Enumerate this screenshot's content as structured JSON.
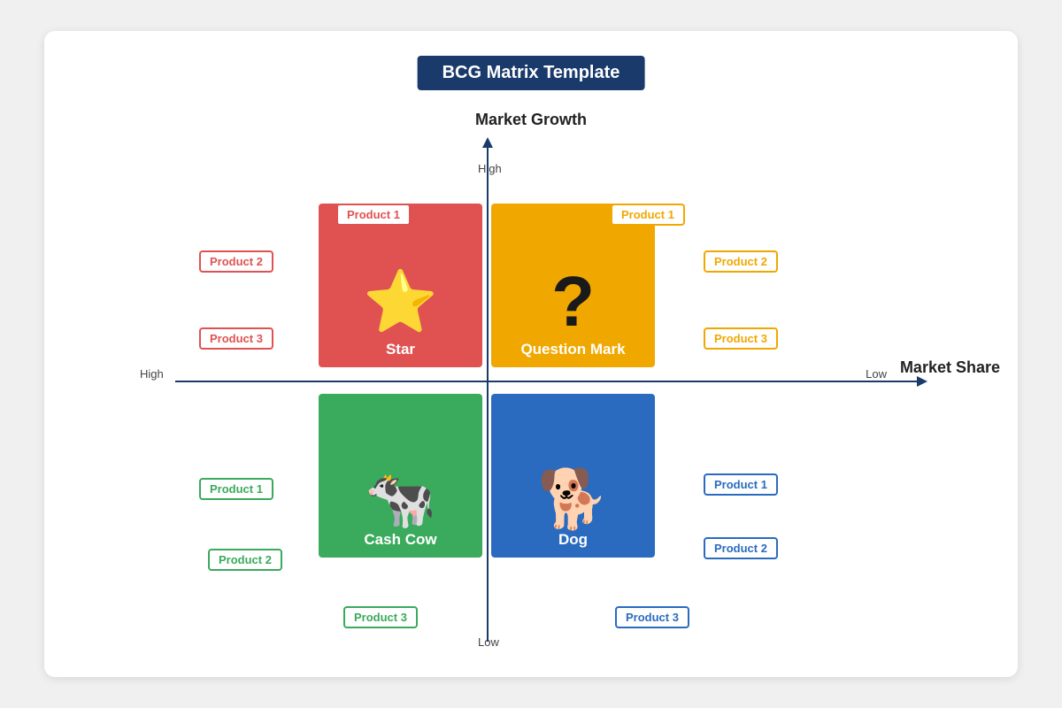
{
  "title": "BCG Matrix Template",
  "axes": {
    "marketGrowth": "Market Growth",
    "marketShare": "Market Share",
    "high": "High",
    "low": "Low",
    "highHorizontal": "High",
    "lowHorizontal": "Low"
  },
  "quadrants": {
    "star": {
      "label": "Star",
      "icon": "⭐",
      "products": [
        "Product 1",
        "Product 2",
        "Product 3"
      ]
    },
    "questionMark": {
      "label": "Question Mark",
      "icon": "?",
      "products": [
        "Product 1",
        "Product 2",
        "Product 3"
      ]
    },
    "cashCow": {
      "label": "Cash Cow",
      "icon": "🐄",
      "products": [
        "Product 1",
        "Product 2",
        "Product 3"
      ]
    },
    "dog": {
      "label": "Dog",
      "icon": "🐕",
      "products": [
        "Product 1",
        "Product 2",
        "Product 3"
      ]
    }
  }
}
